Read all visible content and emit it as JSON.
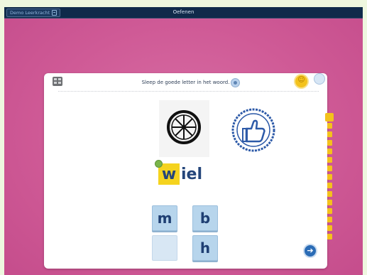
{
  "header": {
    "user_button_label": "Demo Leerkracht",
    "title": "Oefenen"
  },
  "exercise": {
    "instruction": "Sleep de goede letter in het woord.",
    "word_slot_letter": "w",
    "word_rest": "iel",
    "images": [
      "wheel-picture",
      "thumbs-up-stamp"
    ],
    "letter_tiles": [
      "m",
      "b",
      "",
      "h"
    ],
    "progress_segments": 15,
    "progress_current": 1
  },
  "colors": {
    "navbar": "#102a4a",
    "background": "#cf5a96",
    "accent_yellow": "#f5d31e",
    "tile_blue": "#b7d5ec",
    "word_blue": "#24457a",
    "next_button": "#2b6cb6"
  },
  "icons": {
    "menu": "menu-icon",
    "grid": "grid-icon",
    "speaker": "speaker-icon",
    "smiley": "smiley-icon",
    "corner": "circle-button-icon",
    "next": "arrow-right-icon"
  }
}
